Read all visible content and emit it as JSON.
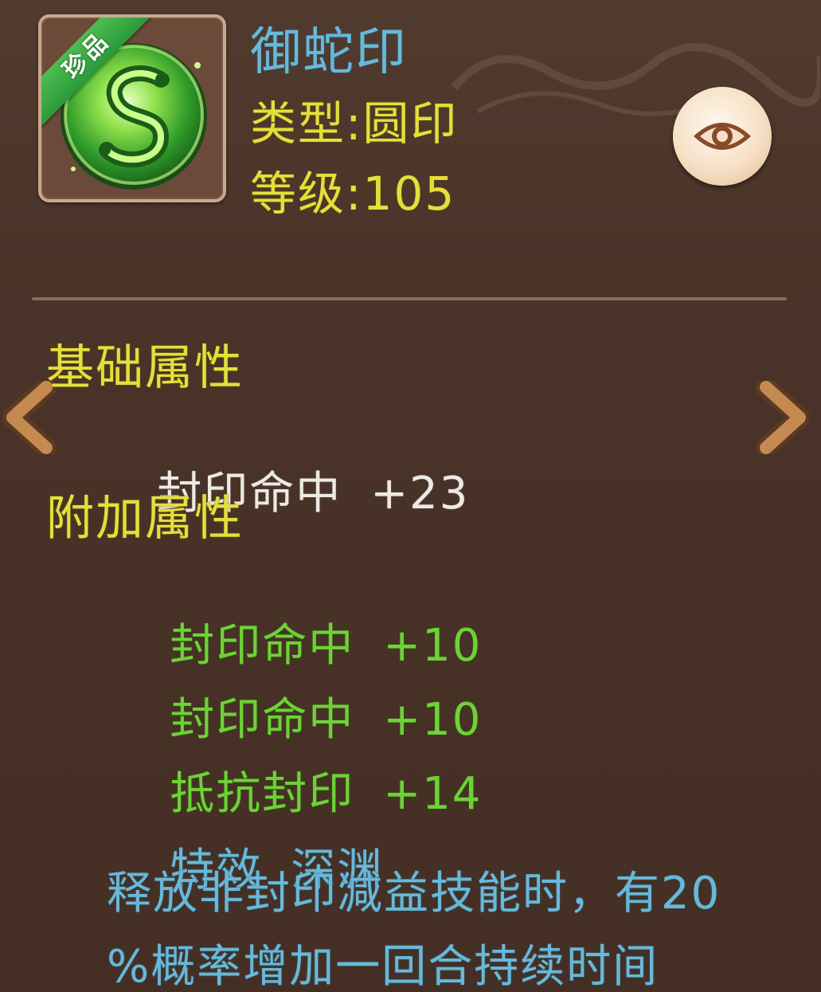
{
  "item": {
    "name": "御蛇印",
    "badge": "珍品",
    "type_label": "类型:",
    "type_value": "圆印",
    "level_label": "等级:",
    "level_value": "105",
    "icon": "serpent-seal-icon"
  },
  "base_section": {
    "title": "基础属性",
    "stats": [
      {
        "name": "封印命中",
        "value": "+23"
      }
    ]
  },
  "extra_section": {
    "title": "附加属性",
    "stats": [
      {
        "name": "封印命中",
        "value": "+10"
      },
      {
        "name": "封印命中",
        "value": "+10"
      },
      {
        "name": "抵抗封印",
        "value": "+14"
      }
    ],
    "effect_label": "特效",
    "effect_name": "深渊",
    "effect_desc_line1": "释放非封印减益技能时，有20",
    "effect_desc_line2": "%概率增加一回合持续时间"
  },
  "controls": {
    "view_icon": "eye-icon",
    "prev_icon": "chevron-left-icon",
    "next_icon": "chevron-right-icon"
  },
  "colors": {
    "background": "#4a3328",
    "name_blue": "#69b8d8",
    "heading_yellow": "#e6de3a",
    "stat_green": "#6ed236",
    "stat_white": "#eeeae3",
    "badge_green": "#2a9a3a"
  }
}
